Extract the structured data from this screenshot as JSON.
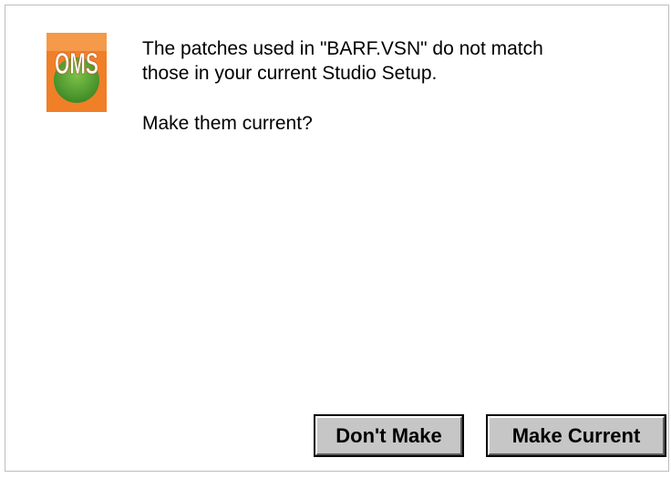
{
  "dialog": {
    "icon": {
      "name": "oms-logo-icon",
      "text": "OMS",
      "colors": {
        "background": "#f07f28",
        "ball": "#4c9a2c",
        "text": "#ffffff"
      }
    },
    "message_line1": "The patches used in \"BARF.VSN\" do not match",
    "message_line2": "those in your current Studio Setup.",
    "question": "Make them current?",
    "buttons": {
      "dont_make": "Don't Make",
      "make_current": "Make Current"
    }
  }
}
